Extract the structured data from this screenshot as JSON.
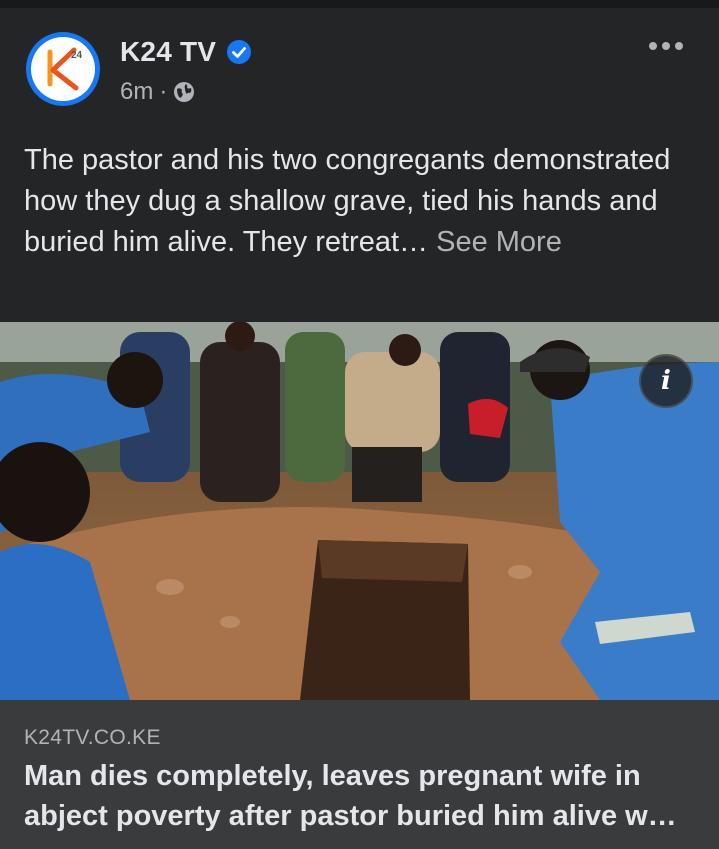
{
  "post": {
    "page_name": "K24 TV",
    "verified_icon": "verified-badge-icon",
    "timestamp": "6m",
    "separator": "·",
    "audience_icon": "globe-icon",
    "more_icon": "more-options-icon",
    "avatar_logo": "K24",
    "avatar_logo_sup": "24",
    "caption": "The pastor and his two congregants demonstrated how they dug a shallow grave, tied his hands and buried him alive. They retreat…",
    "see_more": "See More"
  },
  "media": {
    "info_icon": "info-icon",
    "info_glyph": "i"
  },
  "link": {
    "domain": "K24TV.CO.KE",
    "title": "Man dies completely, leaves pregnant wife in abject poverty after pastor buried him alive w…"
  },
  "colors": {
    "background": "#242526",
    "link_background": "#3a3b3c",
    "verified_blue": "#1877f2",
    "logo_orange": "#f7941d"
  }
}
